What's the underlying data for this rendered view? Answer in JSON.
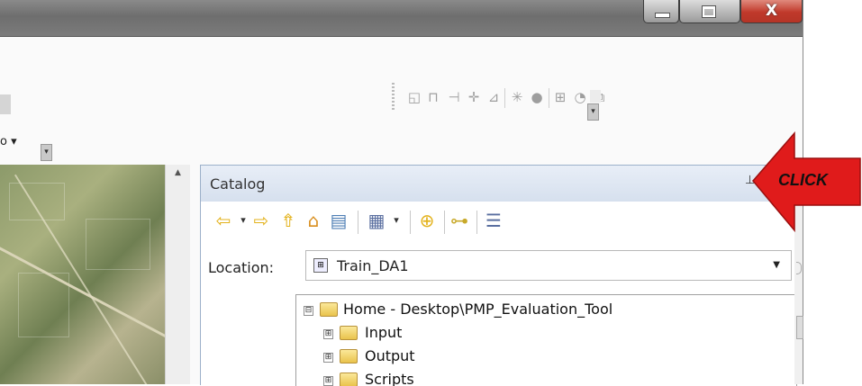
{
  "window": {
    "buttons": {
      "minimize": "minimize-icon",
      "maximize": "maximize-icon",
      "close": "close-icon",
      "close_glyph": "X"
    }
  },
  "toolbar": {
    "icons": [
      "edit-vertices-icon",
      "reshape-icon",
      "cut-polygons-icon",
      "split-icon",
      "trace-icon",
      "snap-icon",
      "sphere-icon",
      "sketch-props-icon",
      "topology-icon",
      "attributes-icon",
      "table-icon",
      "grid-icon",
      "copy-icon",
      "circle-icon"
    ]
  },
  "left_dropdown": {
    "text": "o ▾"
  },
  "catalog": {
    "title": "Catalog",
    "pin_glyph": "⊥",
    "toolbar_icons": [
      "back-arrow-icon",
      "dropdown-arrow-icon",
      "forward-arrow-icon",
      "up-one-level-icon",
      "home-icon",
      "connect-folder-icon",
      "view-options-icon",
      "view-dropdown-icon",
      "add-item-icon",
      "toggle-tree-icon",
      "options-list-icon"
    ],
    "location": {
      "label": "Location:",
      "value": "Train_DA1"
    },
    "tree": [
      {
        "label": "Home - Desktop\\PMP_Evaluation_Tool",
        "expander": "⊟",
        "icon": "home-folder-icon"
      },
      {
        "label": "Input",
        "expander": "⊞",
        "icon": "folder-icon"
      },
      {
        "label": "Output",
        "expander": "⊞",
        "icon": "folder-icon"
      },
      {
        "label": "Scripts",
        "expander": "⊞",
        "icon": "folder-icon"
      }
    ]
  },
  "annotation": {
    "text": "CLICK",
    "color": "#e01b1b"
  }
}
